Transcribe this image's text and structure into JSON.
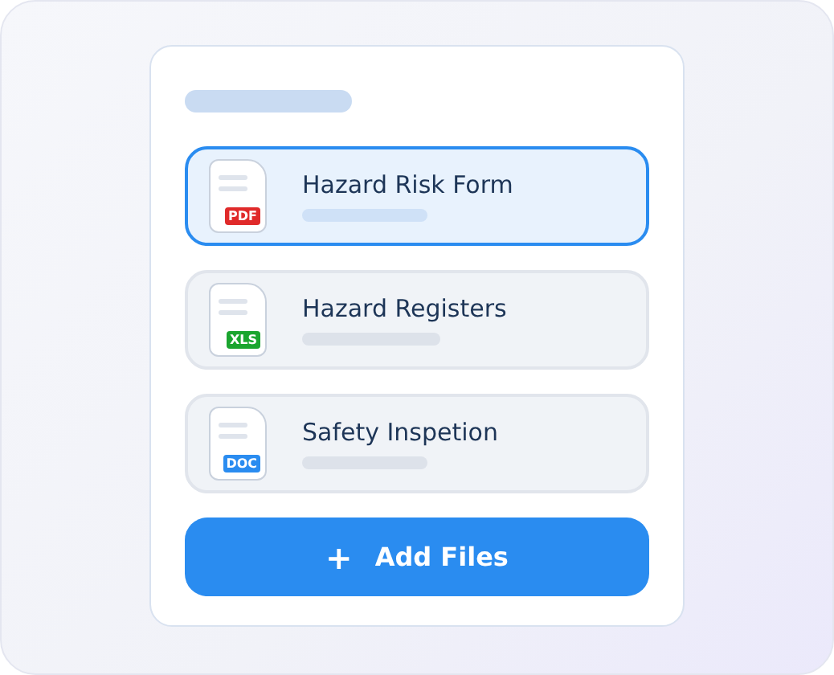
{
  "files": [
    {
      "name": "Hazard Risk Form",
      "type": "PDF",
      "color": "#e02a2a",
      "selected": true
    },
    {
      "name": "Hazard Registers",
      "type": "XLS",
      "color": "#1aa52f",
      "selected": false
    },
    {
      "name": "Safety Inspetion",
      "type": "DOC",
      "color": "#2a8cf0",
      "selected": false
    }
  ],
  "add_button": {
    "icon": "+",
    "label": "Add Files"
  }
}
